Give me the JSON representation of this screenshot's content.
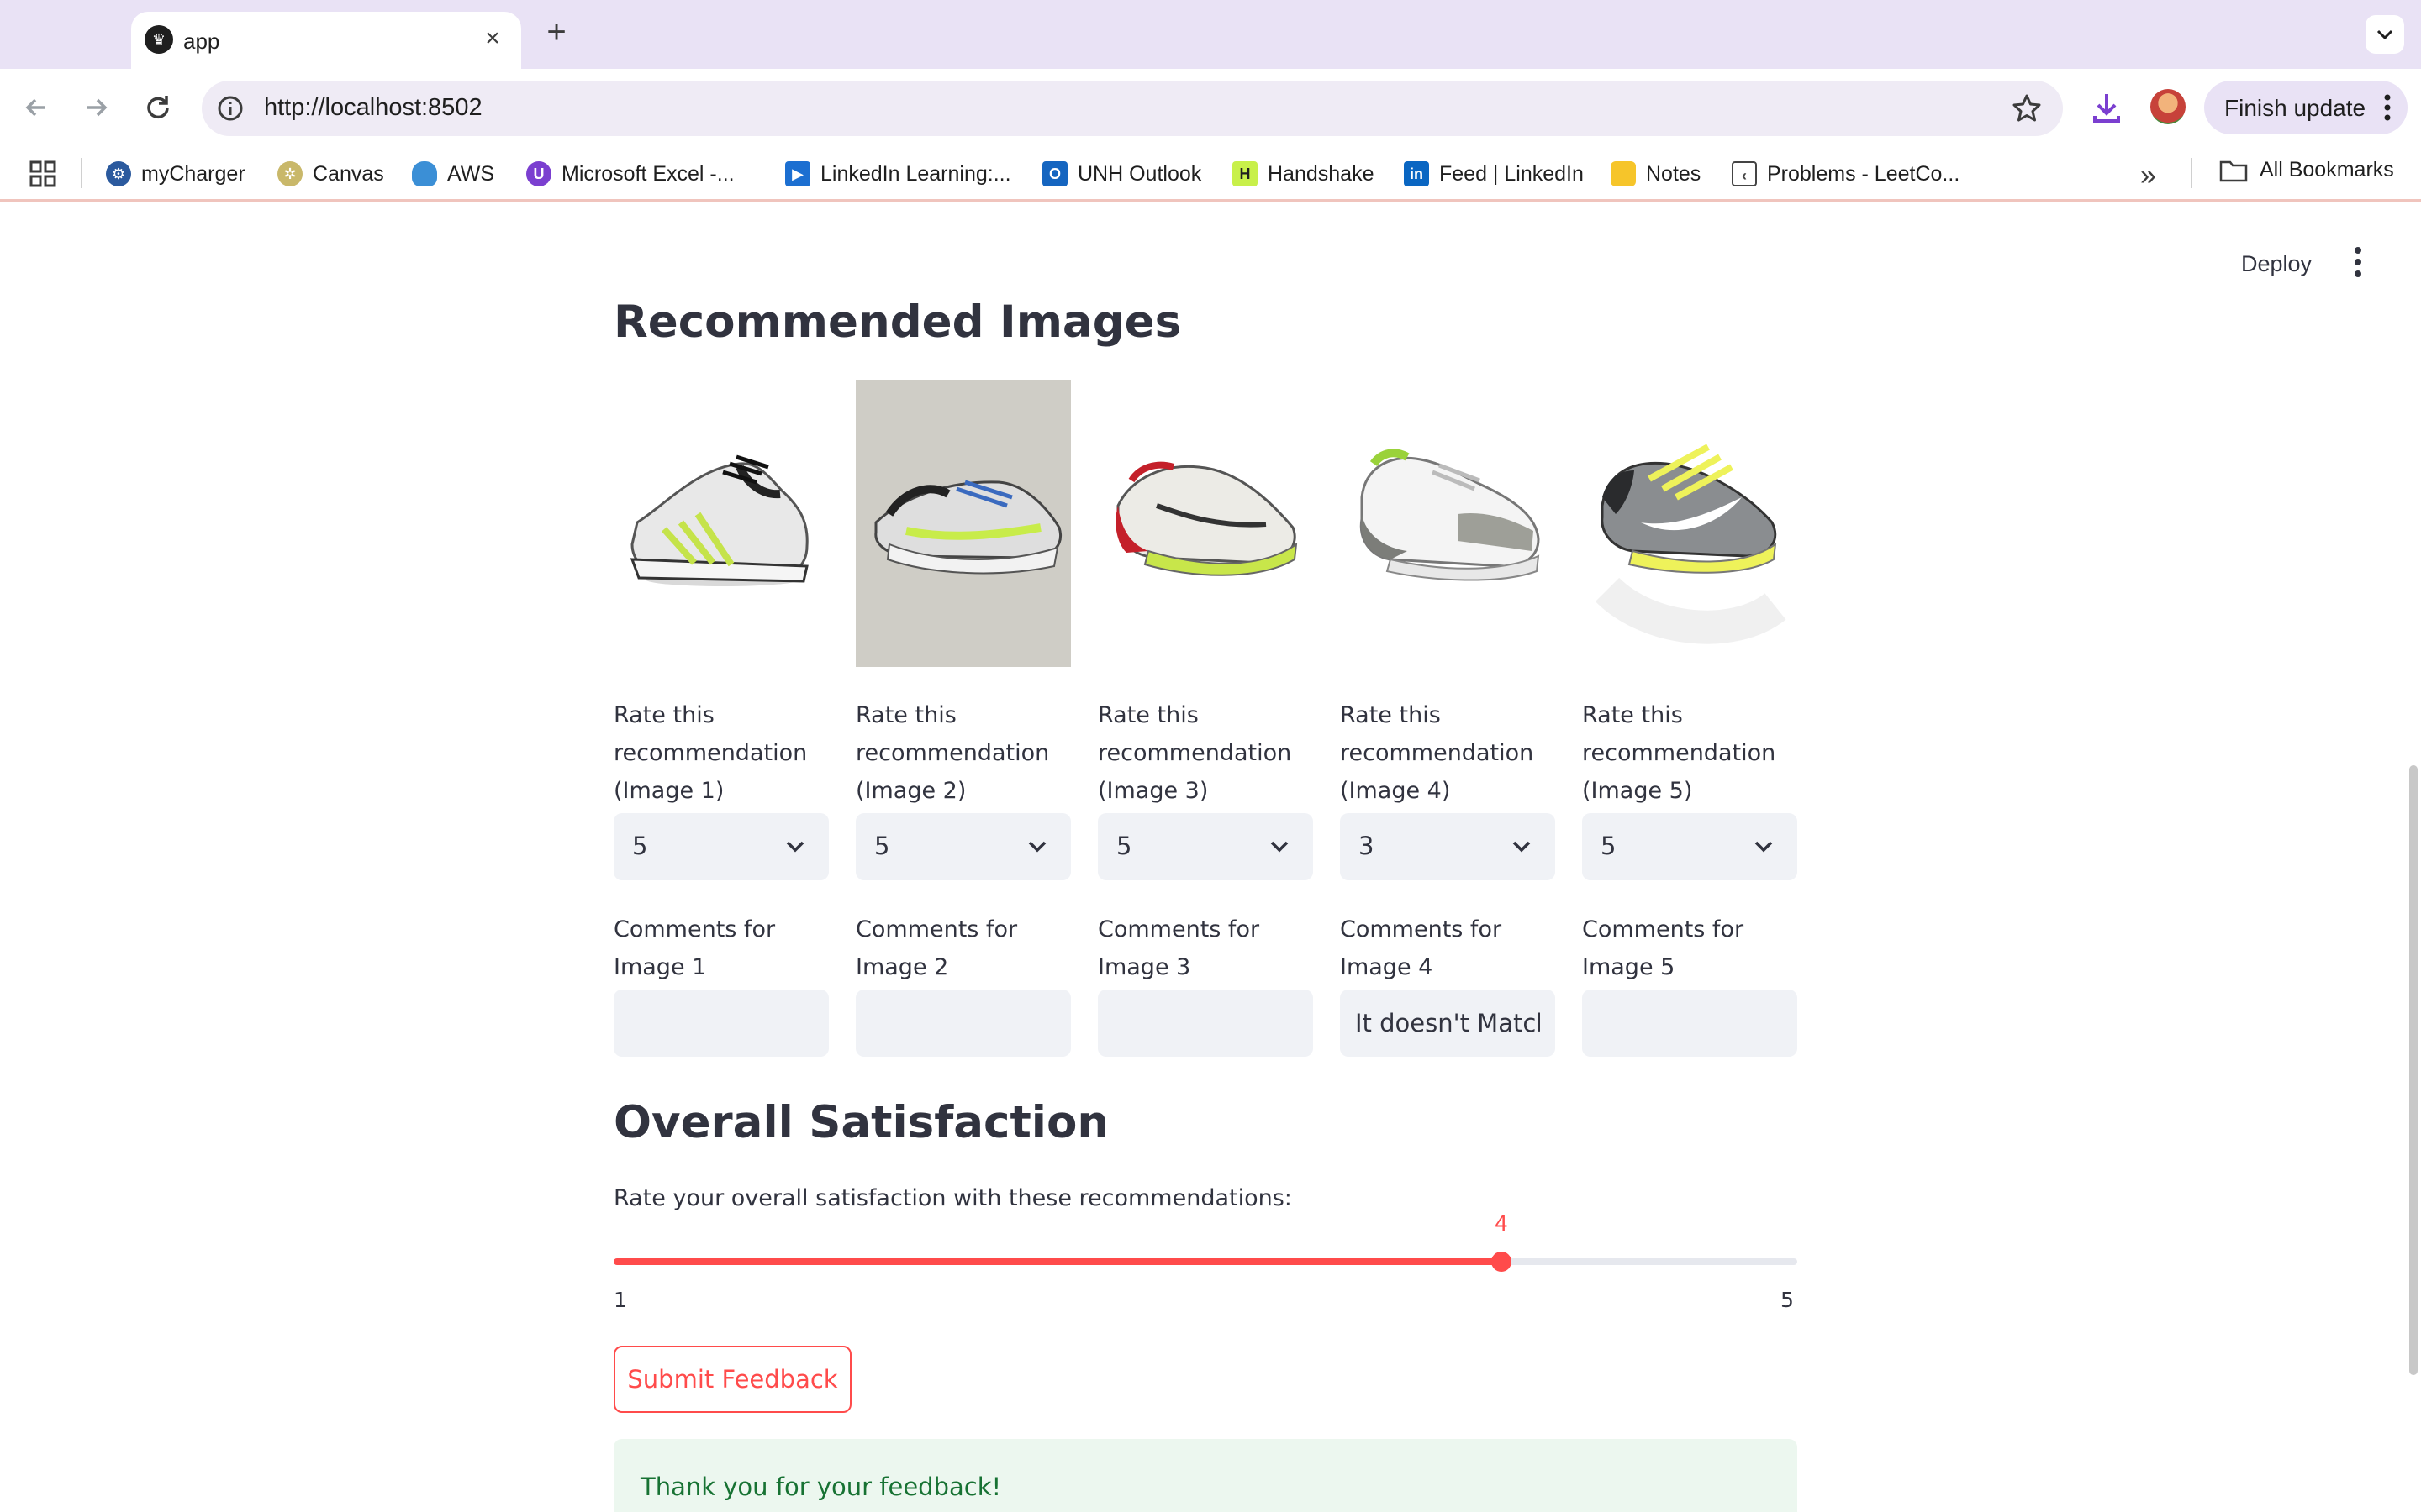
{
  "browser": {
    "tab_title": "app",
    "url": "http://localhost:8502",
    "finish_update_label": "Finish update",
    "bookmarks": [
      {
        "label": "myCharger",
        "icon": "mycharger-icon",
        "color": "#2b5a9e"
      },
      {
        "label": "Canvas",
        "icon": "canvas-icon",
        "color": "#c9b86a"
      },
      {
        "label": "AWS",
        "icon": "aws-cloud-icon",
        "color": "#3b8fd6"
      },
      {
        "label": "Microsoft Excel -...",
        "icon": "unh-u-icon",
        "color": "#7b3fd0"
      },
      {
        "label": "LinkedIn Learning:...",
        "icon": "play-icon",
        "color": "#1c6fd1"
      },
      {
        "label": "UNH Outlook",
        "icon": "outlook-icon",
        "color": "#1565c0"
      },
      {
        "label": "Handshake",
        "icon": "handshake-icon",
        "color": "#c8f04a"
      },
      {
        "label": "Feed | LinkedIn",
        "icon": "linkedin-icon",
        "color": "#0a66c2"
      },
      {
        "label": "Notes",
        "icon": "notes-icon",
        "color": "#f6c52a"
      },
      {
        "label": "Problems - LeetCo...",
        "icon": "leetcode-icon",
        "color": "#444444"
      }
    ],
    "all_bookmarks_label": "All Bookmarks"
  },
  "app": {
    "deploy_label": "Deploy",
    "recommended_title": "Recommended Images",
    "rating_label_prefix": "Rate this recommendation",
    "items": [
      {
        "rate_label": "Rate this recommendation (Image 1)",
        "rating": "5",
        "comment_label": "Comments for Image 1",
        "comment": ""
      },
      {
        "rate_label": "Rate this recommendation (Image 2)",
        "rating": "5",
        "comment_label": "Comments for Image 2",
        "comment": ""
      },
      {
        "rate_label": "Rate this recommendation (Image 3)",
        "rating": "5",
        "comment_label": "Comments for Image 3",
        "comment": ""
      },
      {
        "rate_label": "Rate this recommendation (Image 4)",
        "rating": "3",
        "comment_label": "Comments for Image 4",
        "comment": "It doesn't Match"
      },
      {
        "rate_label": "Rate this recommendation (Image 5)",
        "rating": "5",
        "comment_label": "Comments for Image 5",
        "comment": ""
      }
    ],
    "satisfaction_title": "Overall Satisfaction",
    "satisfaction_question": "Rate your overall satisfaction with these recommendations:",
    "slider": {
      "min": 1,
      "max": 5,
      "value": 4,
      "value_label": "4",
      "min_label": "1",
      "max_label": "5"
    },
    "submit_label": "Submit Feedback",
    "success_message": "Thank you for your feedback!",
    "colors": {
      "accent": "#ff4b4b",
      "text": "#31333f",
      "input_bg": "#f0f2f6",
      "success_bg": "#ecf7ef",
      "success_text": "#177233"
    }
  }
}
